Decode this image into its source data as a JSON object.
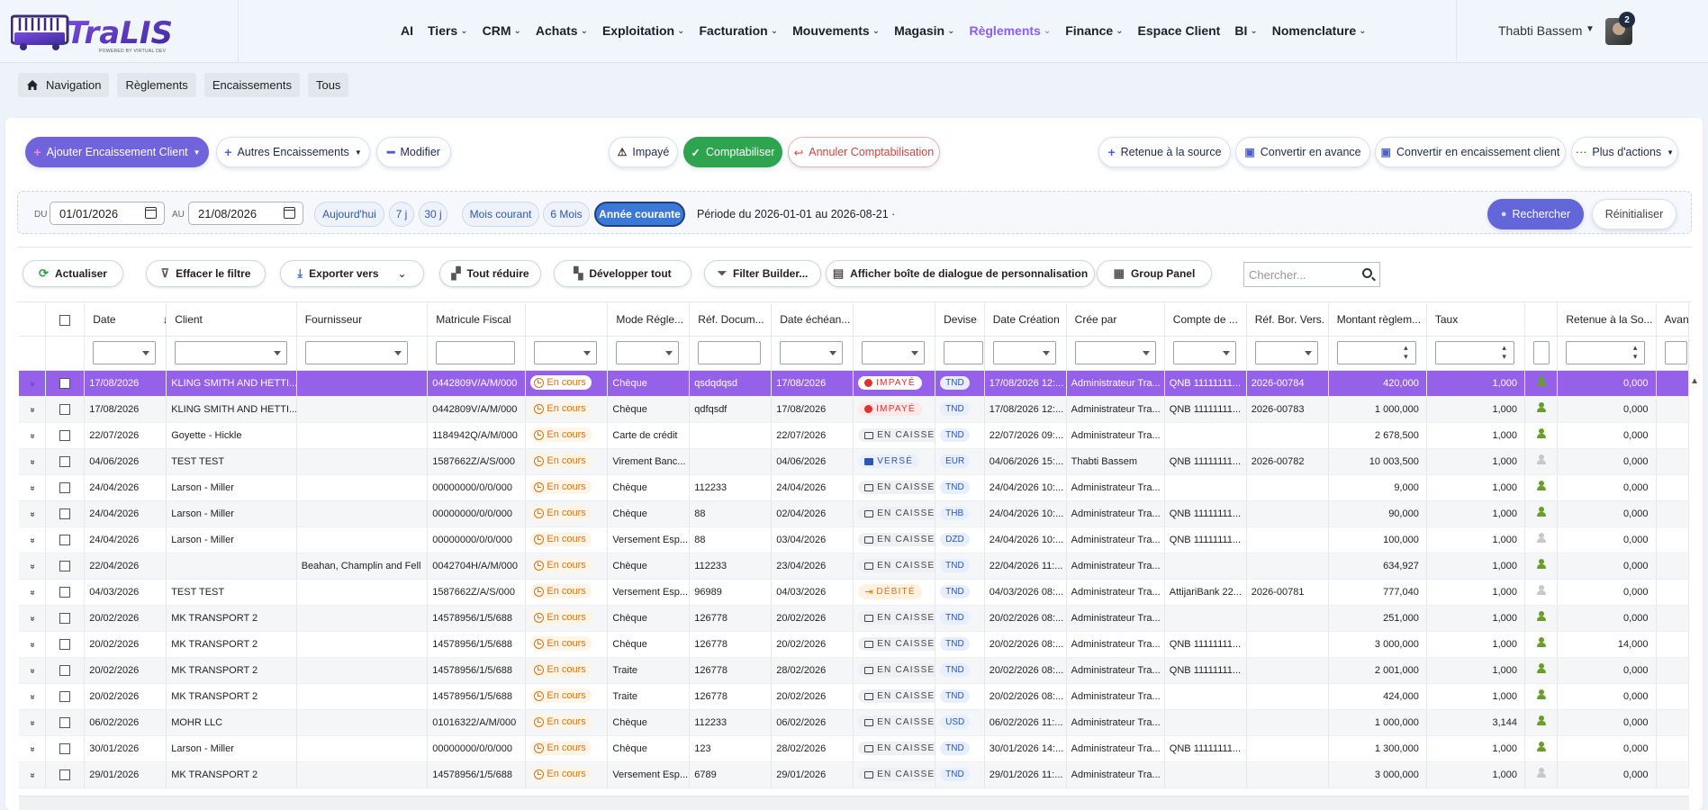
{
  "app": {
    "logo_text": "TraLIS",
    "logo_tagline": "POWERED BY VIRTUAL DEV",
    "nav": [
      {
        "label": "AI",
        "chevron": false
      },
      {
        "label": "Tiers",
        "chevron": true
      },
      {
        "label": "CRM",
        "chevron": true
      },
      {
        "label": "Achats",
        "chevron": true
      },
      {
        "label": "Exploitation",
        "chevron": true
      },
      {
        "label": "Facturation",
        "chevron": true
      },
      {
        "label": "Mouvements",
        "chevron": true
      },
      {
        "label": "Magasin",
        "chevron": true
      },
      {
        "label": "Règlements",
        "chevron": true,
        "active": true
      },
      {
        "label": "Finance",
        "chevron": true
      },
      {
        "label": "Espace Client",
        "chevron": false
      },
      {
        "label": "BI",
        "chevron": true
      },
      {
        "label": "Nomenclature",
        "chevron": true
      }
    ],
    "user": {
      "name": "Thabti Bassem",
      "notifications": "2"
    }
  },
  "breadcrumb": [
    "Navigation",
    "Règlements",
    "Encaissements",
    "Tous"
  ],
  "actions": {
    "add_client": "Ajouter Encaissement Client",
    "other": "Autres Encaissements",
    "edit": "Modifier",
    "unpaid": "Impayé",
    "post": "Comptabiliser",
    "cancel_post": "Annuler Comptabilisation",
    "withholding": "Retenue à la source",
    "to_advance": "Convertir en avance",
    "to_client": "Convertir en encaissement client",
    "more": "Plus d'actions"
  },
  "filters": {
    "du_label": "DU",
    "au_label": "AU",
    "du_value": "01/01/2026",
    "au_value": "21/08/2026",
    "presets": [
      "Aujourd'hui",
      "7 j",
      "30 j",
      "Mois courant",
      "6 Mois",
      "Année courante"
    ],
    "active_preset": "Année courante",
    "period_text": "Période du 2026-01-01 au 2026-08-21 ·",
    "search_btn": "Rechercher",
    "reset_btn": "Réinitialiser"
  },
  "grid_toolbar": {
    "refresh": "Actualiser",
    "clear_filter": "Effacer le filtre",
    "export": "Exporter vers",
    "collapse": "Tout réduire",
    "expand": "Développer tout",
    "filter_builder": "Filter Builder...",
    "custom_dialog": "Afficher boîte de dialogue de personnalisation",
    "group_panel": "Group Panel",
    "search_placeholder": "Chercher..."
  },
  "columns": [
    "",
    "",
    "Date",
    "Client",
    "Fournisseur",
    "Matricule Fiscal",
    "",
    "Mode Régle...",
    "Réf. Docum...",
    "Date échéan...",
    "",
    "Devise",
    "Date Création",
    "Crée par",
    "Compte de ...",
    "Réf. Bor. Vers.",
    "Montant règlem...",
    "Taux",
    "",
    "Retenue à la So...",
    "Avanc"
  ],
  "rows": [
    {
      "date": "17/08/2026",
      "client": "KLING SMITH AND HETTI...",
      "fournisseur": "",
      "mf": "0442809V/A/M/000",
      "etat": "En cours",
      "mode": "Chèque",
      "ref": "qsdqdqsd",
      "echeance": "17/08/2026",
      "statut": "IMPAYÉ",
      "statut_type": "impaye",
      "devise": "TND",
      "creation": "17/08/2026 12:...",
      "cree_par": "Administrateur Tra...",
      "compte": "QNB 11111111...",
      "bor": "2026-00784",
      "montant": "420,000",
      "taux": "1,000",
      "user_on": true,
      "retenue": "0,000",
      "selected": true
    },
    {
      "date": "17/08/2026",
      "client": "KLING SMITH AND HETTI...",
      "fournisseur": "",
      "mf": "0442809V/A/M/000",
      "etat": "En cours",
      "mode": "Chèque",
      "ref": "qdfqsdf",
      "echeance": "17/08/2026",
      "statut": "IMPAYÉ",
      "statut_type": "impaye",
      "devise": "TND",
      "creation": "17/08/2026 12:...",
      "cree_par": "Administrateur Tra...",
      "compte": "QNB 11111111...",
      "bor": "2026-00783",
      "montant": "1 000,000",
      "taux": "1,000",
      "user_on": true,
      "retenue": "0,000"
    },
    {
      "date": "22/07/2026",
      "client": "Goyette - Hickle",
      "fournisseur": "",
      "mf": "1184942Q/A/M/000",
      "etat": "En cours",
      "mode": "Carte de crédit",
      "ref": "",
      "echeance": "22/07/2026",
      "statut": "EN CAISSE",
      "statut_type": "caisse",
      "devise": "TND",
      "creation": "22/07/2026 09:...",
      "cree_par": "Administrateur Tra...",
      "compte": "",
      "bor": "",
      "montant": "2 678,500",
      "taux": "1,000",
      "user_on": true,
      "retenue": "0,000"
    },
    {
      "date": "04/06/2026",
      "client": "TEST TEST",
      "fournisseur": "",
      "mf": "1587662Z/A/S/000",
      "etat": "En cours",
      "mode": "Virement Banc...",
      "ref": "",
      "echeance": "04/06/2026",
      "statut": "VERSÉ",
      "statut_type": "verse",
      "devise": "EUR",
      "creation": "04/06/2026 15:...",
      "cree_par": "Thabti Bassem",
      "compte": "QNB 11111111...",
      "bor": "2026-00782",
      "montant": "10 003,500",
      "taux": "1,000",
      "user_on": false,
      "retenue": "0,000"
    },
    {
      "date": "24/04/2026",
      "client": "Larson - Miller",
      "fournisseur": "",
      "mf": "00000000/0/0/000",
      "etat": "En cours",
      "mode": "Chèque",
      "ref": "112233",
      "echeance": "24/04/2026",
      "statut": "EN CAISSE",
      "statut_type": "caisse",
      "devise": "TND",
      "creation": "24/04/2026 10:...",
      "cree_par": "Administrateur Tra...",
      "compte": "",
      "bor": "",
      "montant": "9,000",
      "taux": "1,000",
      "user_on": true,
      "retenue": "0,000"
    },
    {
      "date": "24/04/2026",
      "client": "Larson - Miller",
      "fournisseur": "",
      "mf": "00000000/0/0/000",
      "etat": "En cours",
      "mode": "Chèque",
      "ref": "88",
      "echeance": "02/04/2026",
      "statut": "EN CAISSE",
      "statut_type": "caisse",
      "devise": "THB",
      "creation": "24/04/2026 10:...",
      "cree_par": "Administrateur Tra...",
      "compte": "QNB 11111111...",
      "bor": "",
      "montant": "90,000",
      "taux": "1,000",
      "user_on": true,
      "retenue": "0,000"
    },
    {
      "date": "24/04/2026",
      "client": "Larson - Miller",
      "fournisseur": "",
      "mf": "00000000/0/0/000",
      "etat": "En cours",
      "mode": "Versement Esp...",
      "ref": "88",
      "echeance": "03/04/2026",
      "statut": "EN CAISSE",
      "statut_type": "caisse",
      "devise": "DZD",
      "creation": "24/04/2026 10:...",
      "cree_par": "Administrateur Tra...",
      "compte": "QNB 11111111...",
      "bor": "",
      "montant": "100,000",
      "taux": "1,000",
      "user_on": false,
      "retenue": "0,000"
    },
    {
      "date": "22/04/2026",
      "client": "",
      "fournisseur": "Beahan, Champlin and Fell",
      "mf": "0042704H/A/M/000",
      "etat": "En cours",
      "mode": "Chèque",
      "ref": "112233",
      "echeance": "23/04/2026",
      "statut": "EN CAISSE",
      "statut_type": "caisse",
      "devise": "TND",
      "creation": "22/04/2026 11:...",
      "cree_par": "Administrateur Tra...",
      "compte": "",
      "bor": "",
      "montant": "634,927",
      "taux": "1,000",
      "user_on": true,
      "retenue": "0,000"
    },
    {
      "date": "04/03/2026",
      "client": "TEST TEST",
      "fournisseur": "",
      "mf": "1587662Z/A/S/000",
      "etat": "En cours",
      "mode": "Versement Esp...",
      "ref": "96989",
      "echeance": "04/03/2026",
      "statut": "DÉBITÉ",
      "statut_type": "debite",
      "devise": "TND",
      "creation": "04/03/2026 08:...",
      "cree_par": "Administrateur Tra...",
      "compte": "AttijariBank 22...",
      "bor": "2026-00781",
      "montant": "777,040",
      "taux": "1,000",
      "user_on": false,
      "retenue": "0,000"
    },
    {
      "date": "20/02/2026",
      "client": "MK TRANSPORT 2",
      "fournisseur": "",
      "mf": "14578956/1/5/688",
      "etat": "En cours",
      "mode": "Chèque",
      "ref": "126778",
      "echeance": "20/02/2026",
      "statut": "EN CAISSE",
      "statut_type": "caisse",
      "devise": "TND",
      "creation": "20/02/2026 08:...",
      "cree_par": "Administrateur Tra...",
      "compte": "",
      "bor": "",
      "montant": "251,000",
      "taux": "1,000",
      "user_on": true,
      "retenue": "0,000"
    },
    {
      "date": "20/02/2026",
      "client": "MK TRANSPORT 2",
      "fournisseur": "",
      "mf": "14578956/1/5/688",
      "etat": "En cours",
      "mode": "Chèque",
      "ref": "126778",
      "echeance": "20/02/2026",
      "statut": "EN CAISSE",
      "statut_type": "caisse",
      "devise": "TND",
      "creation": "20/02/2026 08:...",
      "cree_par": "Administrateur Tra...",
      "compte": "QNB 11111111...",
      "bor": "",
      "montant": "3 000,000",
      "taux": "1,000",
      "user_on": true,
      "retenue": "14,000"
    },
    {
      "date": "20/02/2026",
      "client": "MK TRANSPORT 2",
      "fournisseur": "",
      "mf": "14578956/1/5/688",
      "etat": "En cours",
      "mode": "Traite",
      "ref": "126778",
      "echeance": "28/02/2026",
      "statut": "EN CAISSE",
      "statut_type": "caisse",
      "devise": "TND",
      "creation": "20/02/2026 08:...",
      "cree_par": "Administrateur Tra...",
      "compte": "QNB 11111111...",
      "bor": "",
      "montant": "2 001,000",
      "taux": "1,000",
      "user_on": true,
      "retenue": "0,000"
    },
    {
      "date": "20/02/2026",
      "client": "MK TRANSPORT 2",
      "fournisseur": "",
      "mf": "14578956/1/5/688",
      "etat": "En cours",
      "mode": "Traite",
      "ref": "126778",
      "echeance": "20/02/2026",
      "statut": "EN CAISSE",
      "statut_type": "caisse",
      "devise": "TND",
      "creation": "20/02/2026 08:...",
      "cree_par": "Administrateur Tra...",
      "compte": "",
      "bor": "",
      "montant": "424,000",
      "taux": "1,000",
      "user_on": true,
      "retenue": "0,000"
    },
    {
      "date": "06/02/2026",
      "client": "MOHR LLC",
      "fournisseur": "",
      "mf": "01016322/A/M/000",
      "etat": "En cours",
      "mode": "Chèque",
      "ref": "112233",
      "echeance": "06/02/2026",
      "statut": "EN CAISSE",
      "statut_type": "caisse",
      "devise": "USD",
      "creation": "06/02/2026 11:...",
      "cree_par": "Administrateur Tra...",
      "compte": "",
      "bor": "",
      "montant": "1 000,000",
      "taux": "3,144",
      "user_on": true,
      "retenue": "0,000"
    },
    {
      "date": "30/01/2026",
      "client": "Larson - Miller",
      "fournisseur": "",
      "mf": "00000000/0/0/000",
      "etat": "En cours",
      "mode": "Chèque",
      "ref": "123",
      "echeance": "28/02/2026",
      "statut": "EN CAISSE",
      "statut_type": "caisse",
      "devise": "TND",
      "creation": "30/01/2026 14:...",
      "cree_par": "Administrateur Tra...",
      "compte": "QNB 11111111...",
      "bor": "",
      "montant": "1 300,000",
      "taux": "1,000",
      "user_on": true,
      "retenue": "0,000"
    },
    {
      "date": "29/01/2026",
      "client": "MK TRANSPORT 2",
      "fournisseur": "",
      "mf": "14578956/1/5/688",
      "etat": "En cours",
      "mode": "Versement Esp...",
      "ref": "6789",
      "echeance": "29/01/2026",
      "statut": "EN CAISSE",
      "statut_type": "caisse",
      "devise": "TND",
      "creation": "29/01/2026 11:...",
      "cree_par": "Administrateur Tra...",
      "compte": "",
      "bor": "",
      "montant": "3 000,000",
      "taux": "1,000",
      "user_on": false,
      "retenue": "0,000"
    }
  ]
}
